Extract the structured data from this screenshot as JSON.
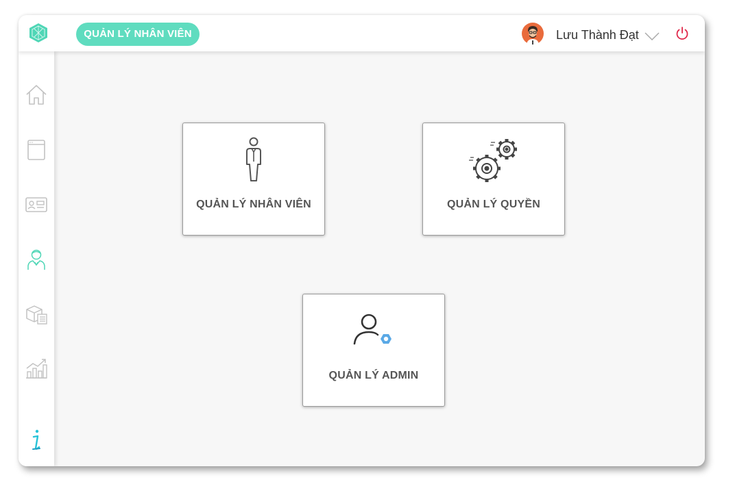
{
  "header": {
    "module_label": "QUẢN LÝ NHÂN VIÊN",
    "user_name": "Lưu Thành Đạt"
  },
  "sidebar": {
    "items": [
      "home-icon",
      "browser-window-icon",
      "id-card-icon",
      "employee-icon",
      "inventory-icon",
      "growth-chart-icon",
      "info-icon"
    ],
    "active_item": "employee-icon"
  },
  "cards": [
    {
      "label": "QUẢN LÝ NHÂN VIÊN",
      "icon": "person-icon"
    },
    {
      "label": "QUẢN LÝ QUYỀN",
      "icon": "gears-icon"
    },
    {
      "label": "QUẢN LÝ ADMIN",
      "icon": "admin-user-icon"
    }
  ],
  "colors": {
    "accent": "#5fdcbf",
    "power": "#e0284a",
    "admin_gear": "#5aa9e6",
    "sidebar_icon": "#bdbdbd"
  }
}
